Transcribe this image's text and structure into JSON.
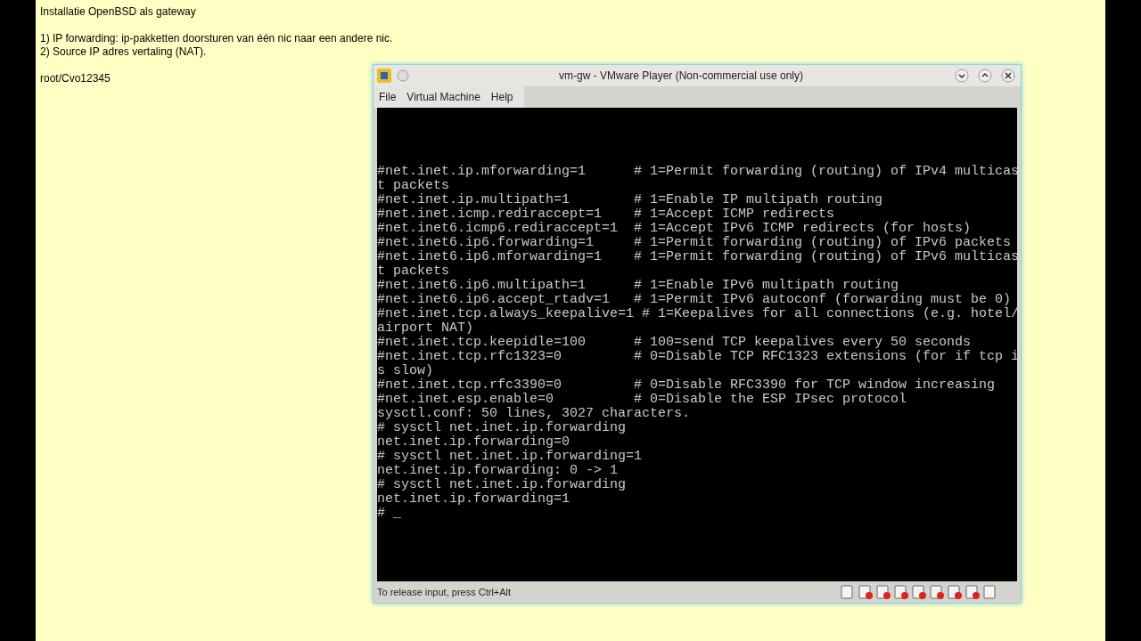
{
  "notes": [
    [
      "Installatie OpenBSD als gateway"
    ],
    [
      "1) IP forwarding: ip-pakketten doorsturen van één nic naar een andere nic.",
      "2) Source IP adres vertaling (NAT)."
    ],
    [
      "root/Cvo12345"
    ]
  ],
  "window": {
    "title": "vm-gw - VMware Player (Non-commercial use only)",
    "menu": [
      "File",
      "Virtual Machine",
      "Help"
    ],
    "terminal": [
      "#net.inet.ip.mforwarding=1      # 1=Permit forwarding (routing) of IPv4 multicas",
      "t packets",
      "#net.inet.ip.multipath=1        # 1=Enable IP multipath routing",
      "#net.inet.icmp.rediraccept=1    # 1=Accept ICMP redirects",
      "#net.inet6.icmp6.rediraccept=1  # 1=Accept IPv6 ICMP redirects (for hosts)",
      "#net.inet6.ip6.forwarding=1     # 1=Permit forwarding (routing) of IPv6 packets",
      "#net.inet6.ip6.mforwarding=1    # 1=Permit forwarding (routing) of IPv6 multicas",
      "t packets",
      "#net.inet6.ip6.multipath=1      # 1=Enable IPv6 multipath routing",
      "#net.inet6.ip6.accept_rtadv=1   # 1=Permit IPv6 autoconf (forwarding must be 0)",
      "#net.inet.tcp.always_keepalive=1 # 1=Keepalives for all connections (e.g. hotel/",
      "airport NAT)",
      "#net.inet.tcp.keepidle=100      # 100=send TCP keepalives every 50 seconds",
      "#net.inet.tcp.rfc1323=0         # 0=Disable TCP RFC1323 extensions (for if tcp i",
      "s slow)",
      "#net.inet.tcp.rfc3390=0         # 0=Disable RFC3390 for TCP window increasing",
      "#net.inet.esp.enable=0          # 0=Disable the ESP IPsec protocol",
      "sysctl.conf: 50 lines, 3027 characters.",
      "# sysctl net.inet.ip.forwarding",
      "net.inet.ip.forwarding=0",
      "# sysctl net.inet.ip.forwarding=1",
      "net.inet.ip.forwarding: 0 -> 1",
      "# sysctl net.inet.ip.forwarding",
      "net.inet.ip.forwarding=1",
      "# _"
    ],
    "status": "To release input, press Ctrl+Alt"
  }
}
